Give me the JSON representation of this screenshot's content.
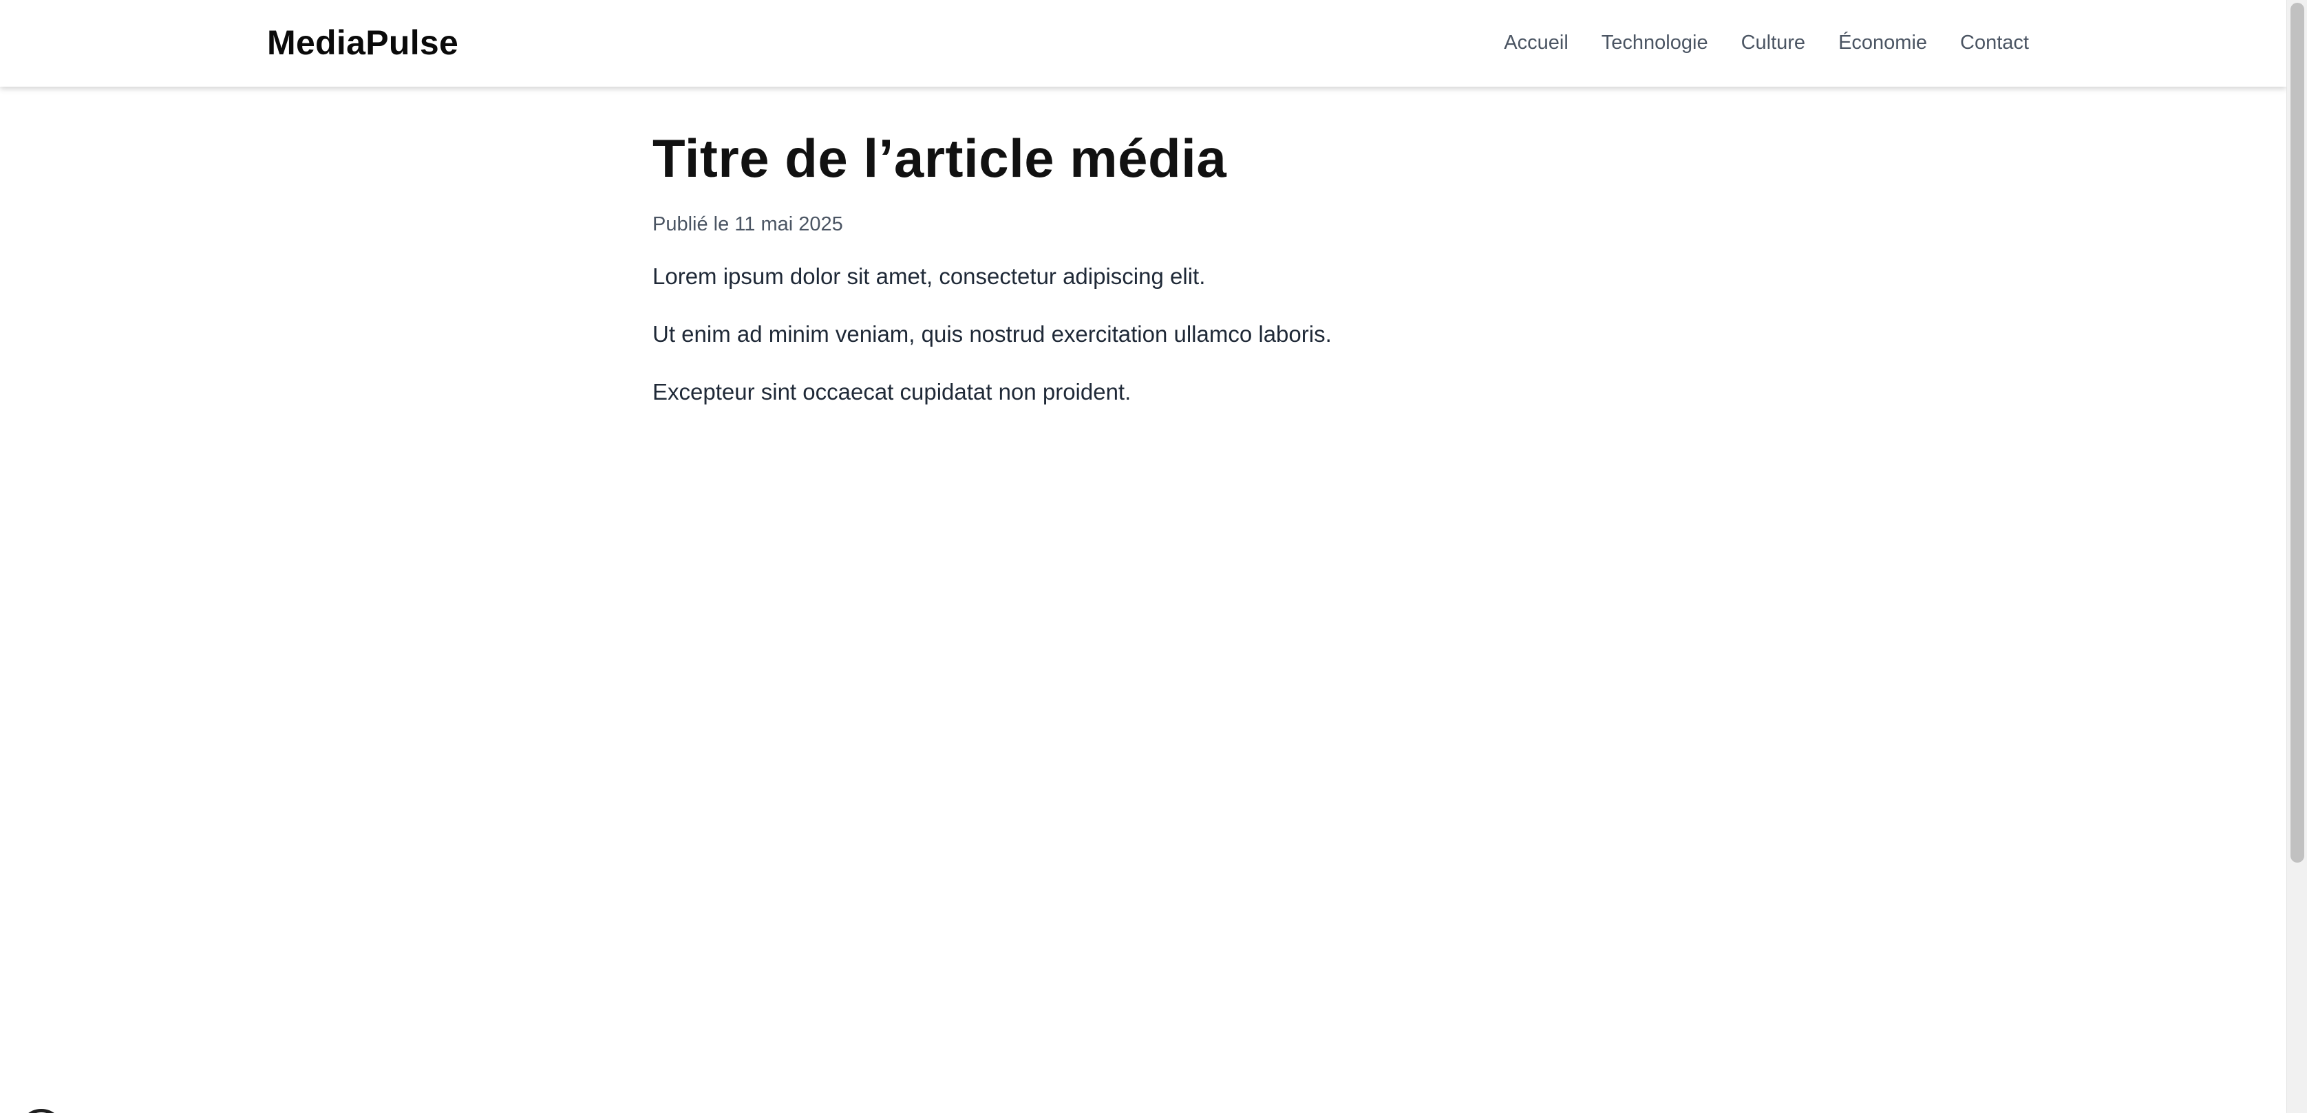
{
  "header": {
    "logo": "MediaPulse",
    "nav": [
      {
        "label": "Accueil"
      },
      {
        "label": "Technologie"
      },
      {
        "label": "Culture"
      },
      {
        "label": "Économie"
      },
      {
        "label": "Contact"
      }
    ]
  },
  "article": {
    "title": "Titre de l’article média",
    "meta": "Publié le 11 mai 2025",
    "paragraphs": [
      "Lorem ipsum dolor sit amet, consectetur adipiscing elit.",
      "Ut enim ad minim veniam, quis nostrud exercitation ullamco laboris.",
      "Excepteur sint occaecat cupidatat non proident."
    ]
  },
  "colors": {
    "text_primary": "#111111",
    "text_muted": "#4b5563",
    "background": "#ffffff"
  }
}
